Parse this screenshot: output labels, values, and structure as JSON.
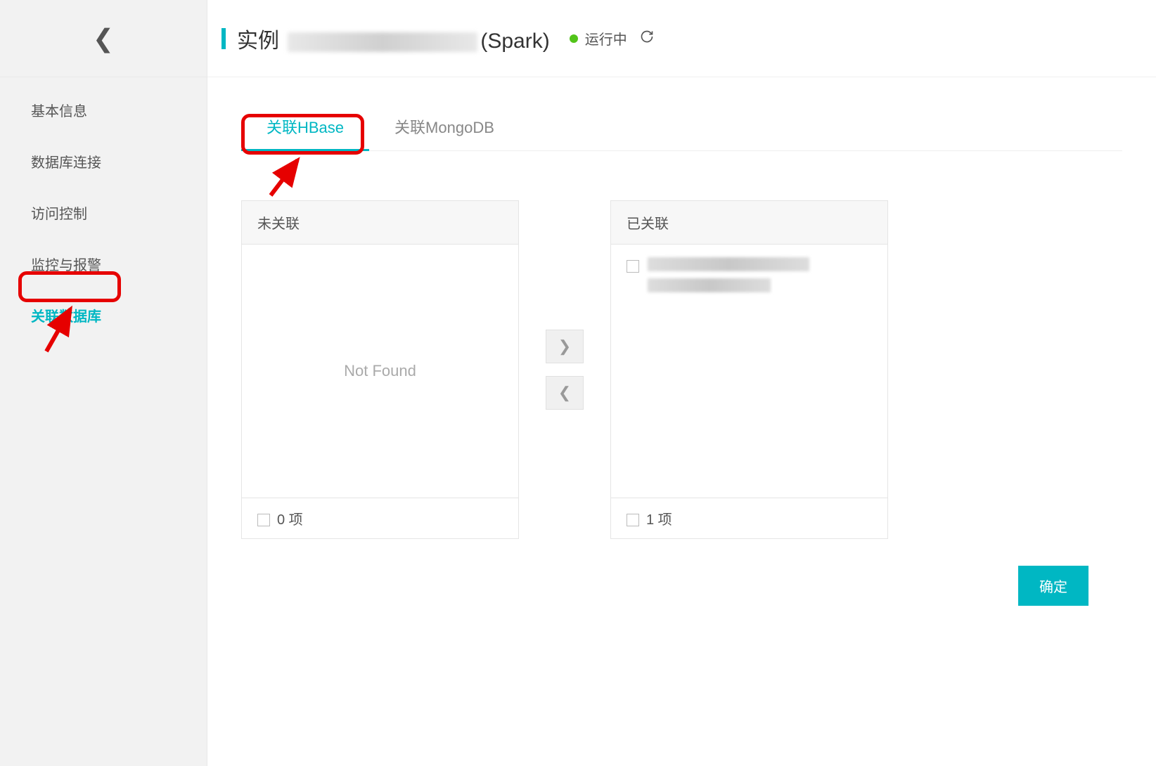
{
  "header": {
    "title_prefix": "实例",
    "title_suffix": "(Spark)",
    "status_text": "运行中"
  },
  "sidebar": {
    "items": [
      {
        "label": "基本信息"
      },
      {
        "label": "数据库连接"
      },
      {
        "label": "访问控制"
      },
      {
        "label": "监控与报警"
      },
      {
        "label": "关联数据库"
      }
    ]
  },
  "tabs": [
    {
      "label": "关联HBase"
    },
    {
      "label": "关联MongoDB"
    }
  ],
  "transfer": {
    "left_title": "未关联",
    "right_title": "已关联",
    "empty_text": "Not Found",
    "left_footer": "0 项",
    "right_footer": "1 项"
  },
  "buttons": {
    "confirm": "确定"
  }
}
